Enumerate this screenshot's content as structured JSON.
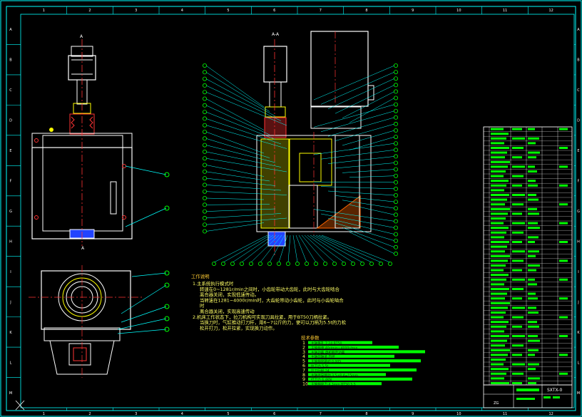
{
  "drawing": {
    "column_markers": [
      "1",
      "2",
      "3",
      "4",
      "5",
      "6",
      "7",
      "8",
      "9",
      "10",
      "11",
      "12"
    ],
    "row_markers": [
      "A",
      "B",
      "C",
      "D",
      "E",
      "F",
      "G",
      "H",
      "I",
      "J",
      "K",
      "L",
      "M"
    ],
    "section_label_left": "A",
    "section_label_top": "A-A",
    "section_label_bottom": "A"
  },
  "notes": {
    "title": "工作说明",
    "lines": [
      "1.主系统执行模式时",
      "转速在0~1281r/min之间时，小齿轮带动大齿轮，此时与大齿轮啮合",
      "离合器关闭，实现低速传动。",
      "当转速在1281~4000r/min时，大齿轮带动小齿轮，此时与小齿轮啮合",
      "时",
      "离合器关闭，实现高速传动",
      "2.机床工作状态下，拉刀机构可实现刀具拉紧，用于BT50刀柄拉紧。",
      "当换刀时，气缸推动打刀杆，用6~7公斤的力，使可以刀柄为5.5t的力松",
      "松开打刀，松开拉紧，实现换刀动作。"
    ],
    "spec_title": "技术参数",
    "specs": [
      {
        "num": "1",
        "text": "主轴锥孔 7:24 BT50"
      },
      {
        "num": "2",
        "text": "主轴转速 40r/min~4000r/min"
      },
      {
        "num": "3",
        "text": "主轴功率 电机额定功率"
      },
      {
        "num": "4",
        "text": "主轴前轴承 内径"
      },
      {
        "num": "5",
        "text": "主轴轴向跳动 0.005"
      },
      {
        "num": "6",
        "text": "拉刀力 5.5t"
      },
      {
        "num": "7",
        "text": "拉刀行程 24"
      },
      {
        "num": "8",
        "text": "主轴径向跳动 3.5+8.4=15mm"
      },
      {
        "num": "9",
        "text": "打刀力 6.4KN"
      },
      {
        "num": "10",
        "text": "主轴轴向力 4.3mm BT50 5.5"
      }
    ]
  },
  "title_block": {
    "drawing_no": "SXTX-0",
    "material": "ZG"
  },
  "colors": {
    "frame": "#00ffff",
    "outline": "#ffffff",
    "leader": "#00ffff",
    "center": "#ff3333",
    "part_yellow": "#ffff00",
    "part_blue": "#2244ff",
    "table_green": "#00ff00",
    "balloon": "#00ff00"
  }
}
